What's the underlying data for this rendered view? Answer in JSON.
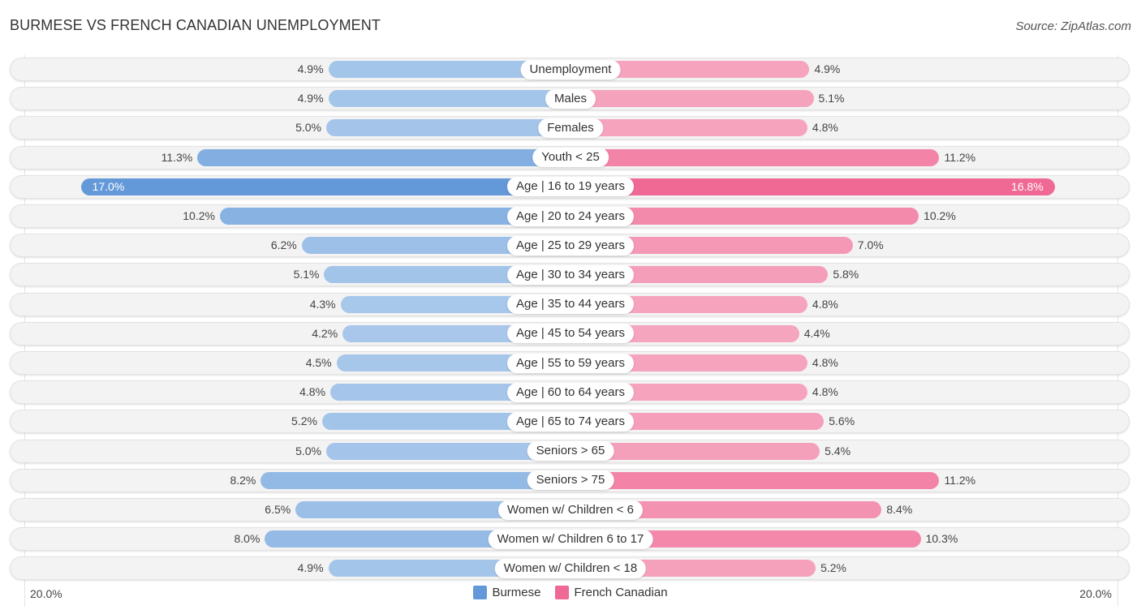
{
  "header": {
    "title": "BURMESE VS FRENCH CANADIAN UNEMPLOYMENT",
    "source": "Source: ZipAtlas.com"
  },
  "colors": {
    "burmese_strong": "#6499d9",
    "burmese_light": "#a9c8eb",
    "french_strong": "#f06894",
    "french_light": "#f6a7c0"
  },
  "chart_data": {
    "type": "bar",
    "orientation": "horizontal-diverging",
    "title": "BURMESE VS FRENCH CANADIAN UNEMPLOYMENT",
    "unit": "%",
    "axis_max": 20.0,
    "axis_labels": {
      "left": "20.0%",
      "right": "20.0%"
    },
    "legend": [
      "Burmese",
      "French Canadian"
    ],
    "legend_position": "bottom-center",
    "categories": [
      "Unemployment",
      "Males",
      "Females",
      "Youth < 25",
      "Age | 16 to 19 years",
      "Age | 20 to 24 years",
      "Age | 25 to 29 years",
      "Age | 30 to 34 years",
      "Age | 35 to 44 years",
      "Age | 45 to 54 years",
      "Age | 55 to 59 years",
      "Age | 60 to 64 years",
      "Age | 65 to 74 years",
      "Seniors > 65",
      "Seniors > 75",
      "Women w/ Children < 6",
      "Women w/ Children 6 to 17",
      "Women w/ Children < 18"
    ],
    "series": [
      {
        "name": "Burmese",
        "values": [
          4.9,
          4.9,
          5.0,
          11.3,
          17.0,
          10.2,
          6.2,
          5.1,
          4.3,
          4.2,
          4.5,
          4.8,
          5.2,
          5.0,
          8.2,
          6.5,
          8.0,
          4.9
        ]
      },
      {
        "name": "French Canadian",
        "values": [
          4.9,
          5.1,
          4.8,
          11.2,
          16.8,
          10.2,
          7.0,
          5.8,
          4.8,
          4.4,
          4.8,
          4.8,
          5.6,
          5.4,
          11.2,
          8.4,
          10.3,
          5.2
        ]
      }
    ]
  }
}
